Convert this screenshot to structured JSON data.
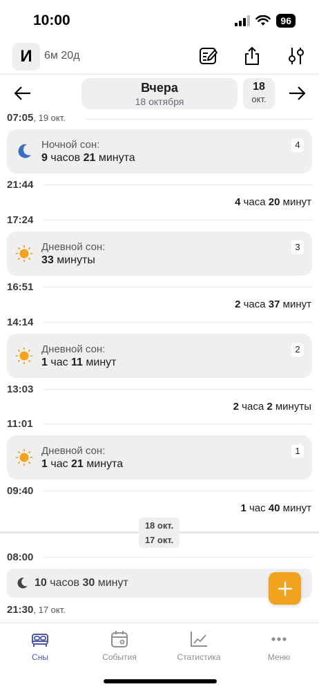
{
  "status": {
    "time": "10:00",
    "battery": "96"
  },
  "header": {
    "avatar_letter": "И",
    "age": "6м 20д"
  },
  "date_nav": {
    "title": "Вчера",
    "subtitle": "18 октября",
    "next_day": "18",
    "next_month": "окт."
  },
  "timeline": {
    "t1": {
      "time": "07:05",
      "date": ", 19 окт."
    },
    "card4": {
      "title": "Ночной сон:",
      "v1": "9",
      "u1": " часов ",
      "v2": "21",
      "u2": " минута",
      "num": "4"
    },
    "t2": "21:44",
    "gap1": {
      "v1": "4",
      "u1": " часа ",
      "v2": "20",
      "u2": " минут"
    },
    "t3": "17:24",
    "card3": {
      "title": "Дневной сон:",
      "v1": "33",
      "u1": " минуты",
      "num": "3"
    },
    "t4": "16:51",
    "gap2": {
      "v1": "2",
      "u1": " часа ",
      "v2": "37",
      "u2": " минут"
    },
    "t5": "14:14",
    "card2": {
      "title": "Дневной сон:",
      "v1": "1",
      "u1": " час ",
      "v2": "11",
      "u2": " минут",
      "num": "2"
    },
    "t6": "13:03",
    "gap3": {
      "v1": "2",
      "u1": " часа ",
      "v2": "2",
      "u2": " минуты"
    },
    "t7": "11:01",
    "card1": {
      "title": "Дневной сон:",
      "v1": "1",
      "u1": " час ",
      "v2": "21",
      "u2": " минута",
      "num": "1"
    },
    "t8": "09:40",
    "gap4": {
      "v1": "1",
      "u1": " час ",
      "v2": "40",
      "u2": " минут"
    },
    "sep": {
      "a": "18 окт.",
      "b": "17 окт."
    },
    "t9": "08:00",
    "prev_card": {
      "v1": "10",
      "u1": " часов ",
      "v2": "30",
      "u2": " минут"
    },
    "t10": {
      "time": "21:30",
      "date": ", 17 окт."
    }
  },
  "bottom_nav": {
    "sleep": "Сны",
    "events": "События",
    "stats": "Статистика",
    "menu": "Меню"
  },
  "colors": {
    "accent": "#f0a41e",
    "active_tab": "#4e58a8",
    "moon": "#3a6fc4",
    "sun": "#f2a31b"
  }
}
